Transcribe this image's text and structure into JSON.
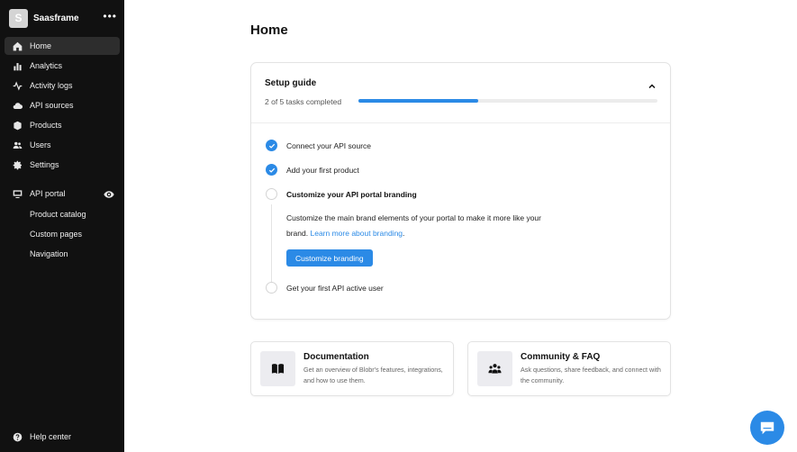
{
  "workspace": {
    "initial": "S",
    "name": "Saasframe",
    "more_icon": "more-horizontal-icon"
  },
  "sidebar": {
    "items": [
      {
        "label": "Home",
        "icon": "home-icon",
        "active": true
      },
      {
        "label": "Analytics",
        "icon": "bar-chart-icon"
      },
      {
        "label": "Activity logs",
        "icon": "activity-icon"
      },
      {
        "label": "API sources",
        "icon": "cloud-icon"
      },
      {
        "label": "Products",
        "icon": "box-icon"
      },
      {
        "label": "Users",
        "icon": "users-icon"
      },
      {
        "label": "Settings",
        "icon": "gear-icon"
      }
    ],
    "portal": {
      "label": "API portal",
      "icon": "monitor-icon",
      "visibility_icon": "eye-icon"
    },
    "portal_items": [
      "Product catalog",
      "Custom pages",
      "Navigation"
    ],
    "help": {
      "label": "Help center",
      "icon": "help-circle-icon"
    }
  },
  "main": {
    "title": "Home",
    "setup_guide": {
      "title": "Setup guide",
      "progress_text": "2 of 5 tasks completed",
      "progress": 0.4,
      "collapse_icon": "chevron-up-icon",
      "tasks": [
        {
          "label": "Connect your API source",
          "done": true
        },
        {
          "label": "Add your first product",
          "done": true
        },
        {
          "label": "Customize your API portal branding",
          "done": false,
          "current": true
        },
        {
          "label": "Get your first API active user",
          "done": false
        }
      ],
      "current_desc": "Customize the main brand elements of your portal to make it more like your brand.",
      "current_link": "Learn more about branding",
      "current_cta": "Customize branding"
    },
    "resources": [
      {
        "title": "Documentation",
        "desc": "Get an overview of Blobr's features, integrations, and how to use them.",
        "icon": "book-icon"
      },
      {
        "title": "Community & FAQ",
        "desc": "Ask questions, share feedback, and connect with the community.",
        "icon": "community-icon"
      }
    ]
  },
  "chat": {
    "icon": "chat-icon"
  },
  "colors": {
    "accent": "#2b8ae6",
    "sidebar_bg": "#111111"
  }
}
